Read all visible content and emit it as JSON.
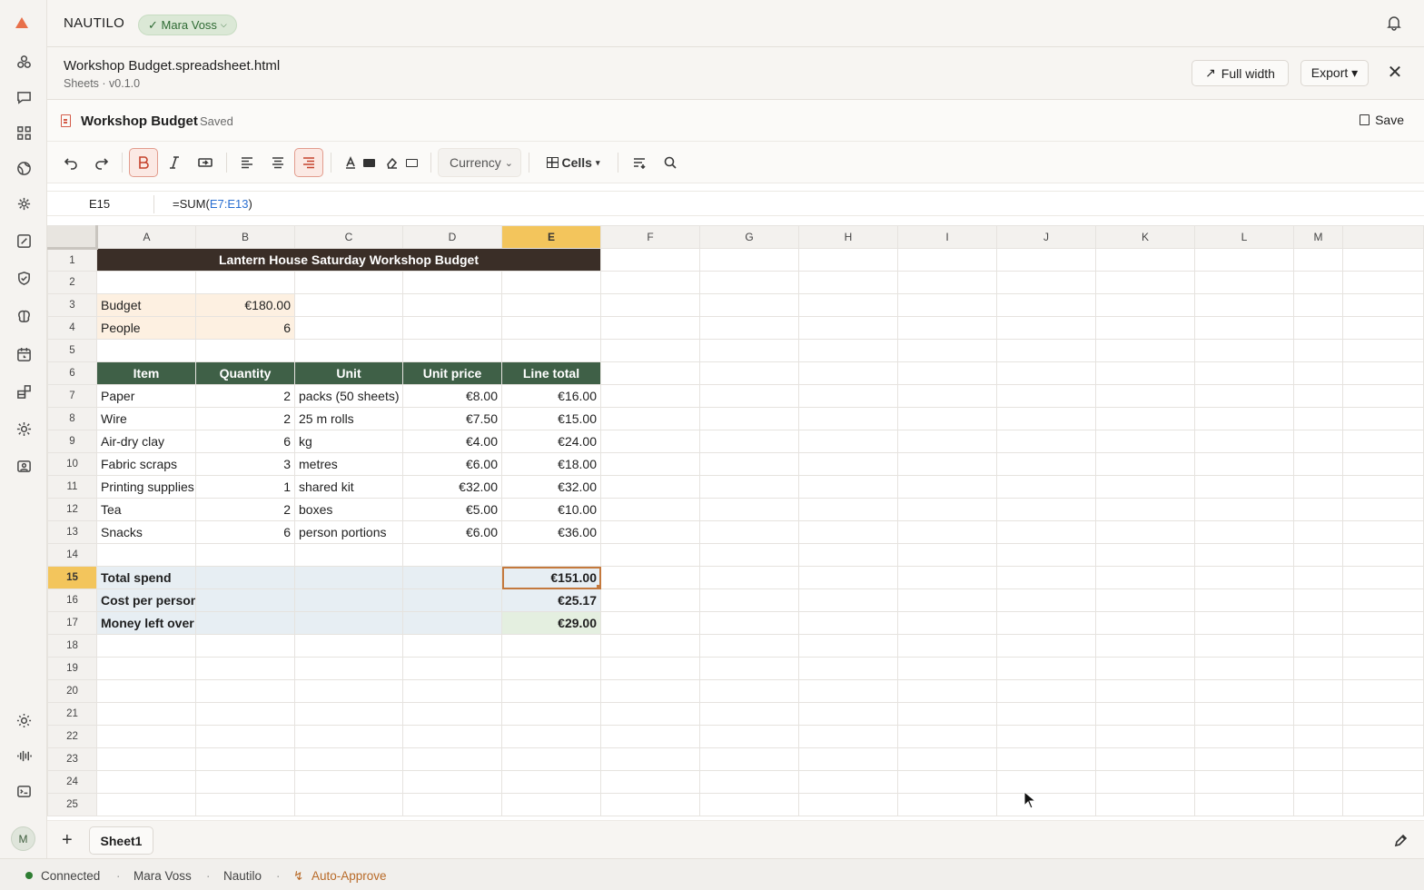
{
  "app": {
    "brand": "NAUTILO",
    "user_pill": "✓ Mara Voss",
    "doc_title": "Workshop Budget.spreadsheet.html",
    "doc_sub": "Sheets · v0.1.0",
    "full_width_label": "Full width",
    "export_label": "Export ▾"
  },
  "sheet": {
    "name": "Workshop Budget",
    "status": "Saved",
    "save_label": "Save",
    "number_format": "Currency",
    "cells_menu": "Cells",
    "cell_ref": "E15",
    "formula_prefix": "=SUM(",
    "formula_ref": "E7:E13",
    "formula_suffix": ")",
    "columns": [
      "A",
      "B",
      "C",
      "D",
      "E",
      "F",
      "G",
      "H",
      "I",
      "J",
      "K",
      "L",
      "M"
    ],
    "selected_column": "E",
    "selected_row": "15",
    "title": "Lantern House Saturday Workshop Budget",
    "inputs": [
      {
        "label": "Budget",
        "value": "€180.00"
      },
      {
        "label": "People",
        "value": "6"
      }
    ],
    "table_headers": [
      "Item",
      "Quantity",
      "Unit",
      "Unit price",
      "Line total"
    ],
    "rows": [
      {
        "item": "Paper",
        "qty": "2",
        "unit": "packs (50 sheets)",
        "price": "€8.00",
        "total": "€16.00"
      },
      {
        "item": "Wire",
        "qty": "2",
        "unit": "25 m rolls",
        "price": "€7.50",
        "total": "€15.00"
      },
      {
        "item": "Air-dry clay",
        "qty": "6",
        "unit": "kg",
        "price": "€4.00",
        "total": "€24.00"
      },
      {
        "item": "Fabric scraps",
        "qty": "3",
        "unit": "metres",
        "price": "€6.00",
        "total": "€18.00"
      },
      {
        "item": "Printing supplies",
        "qty": "1",
        "unit": "shared kit",
        "price": "€32.00",
        "total": "€32.00"
      },
      {
        "item": "Tea",
        "qty": "2",
        "unit": "boxes",
        "price": "€5.00",
        "total": "€10.00"
      },
      {
        "item": "Snacks",
        "qty": "6",
        "unit": "person portions",
        "price": "€6.00",
        "total": "€36.00"
      }
    ],
    "summary": [
      {
        "label": "Total spend",
        "value": "€151.00"
      },
      {
        "label": "Cost per person",
        "value": "€25.17"
      },
      {
        "label": "Money left over",
        "value": "€29.00"
      }
    ],
    "tab_name": "Sheet1"
  },
  "status": {
    "connected": "Connected",
    "user": "Mara Voss",
    "workspace": "Nautilo",
    "mode": "Auto-Approve",
    "sep": "·"
  },
  "colors": {
    "accent": "#e8704a",
    "title_fill": "#3a2e27",
    "header_fill": "#3f6047",
    "input_fill": "#fdf0e1",
    "summary_fill": "#e7eef3",
    "leftover_fill": "#e4efe0",
    "selection": "#c4793d"
  }
}
